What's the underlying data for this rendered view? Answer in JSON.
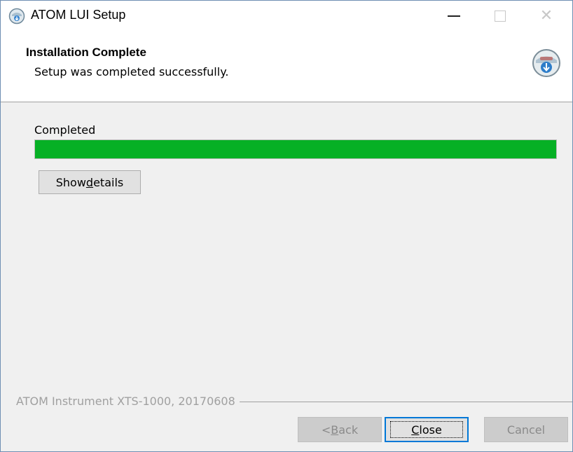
{
  "window": {
    "title": "ATOM LUI Setup",
    "controls": {
      "minimize_icon": "minimize-icon",
      "maximize_icon": "maximize-icon",
      "close_icon": "close-icon",
      "close_glyph": "✕"
    }
  },
  "header": {
    "title": "Installation Complete",
    "subtitle": "Setup was completed successfully."
  },
  "progress": {
    "label": "Completed",
    "value_percent": 100,
    "color": "#06b025"
  },
  "details_button": {
    "label_pre": "Show ",
    "label_accel": "d",
    "label_post": "etails"
  },
  "branding": {
    "text": "ATOM Instrument XTS-1000, 20170608"
  },
  "footer": {
    "back": {
      "pre": "< ",
      "accel": "B",
      "post": "ack",
      "enabled": false
    },
    "close": {
      "pre": "",
      "accel": "C",
      "post": "lose",
      "enabled": true
    },
    "cancel": {
      "label": "Cancel",
      "enabled": false
    }
  },
  "colors": {
    "accent": "#0078d7",
    "progress_green": "#06b025"
  }
}
